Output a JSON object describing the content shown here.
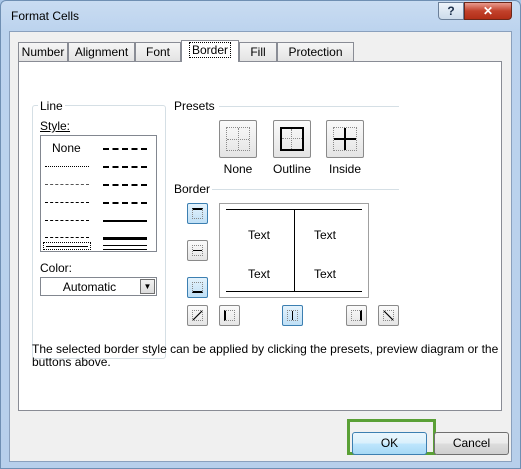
{
  "window": {
    "title": "Format Cells",
    "help_label": "?",
    "close_label": "✕"
  },
  "tabs": [
    {
      "label": "Number",
      "active": false
    },
    {
      "label": "Alignment",
      "active": false
    },
    {
      "label": "Font",
      "active": false
    },
    {
      "label": "Border",
      "active": true
    },
    {
      "label": "Fill",
      "active": false
    },
    {
      "label": "Protection",
      "active": false
    }
  ],
  "line": {
    "group_label": "Line",
    "style_label": "Style:",
    "none_label": "None",
    "color_label": "Color:",
    "color_value": "Automatic"
  },
  "presets": {
    "group_label": "Presets",
    "items": [
      {
        "label": "None",
        "icon": "preset-none-icon"
      },
      {
        "label": "Outline",
        "icon": "preset-outline-icon"
      },
      {
        "label": "Inside",
        "icon": "preset-inside-icon"
      }
    ]
  },
  "border": {
    "group_label": "Border",
    "preview_texts": [
      "Text",
      "Text",
      "Text",
      "Text"
    ]
  },
  "description": "The selected border style can be applied by clicking the presets, preview diagram or the buttons above.",
  "buttons": {
    "ok": "OK",
    "cancel": "Cancel"
  },
  "colors": {
    "highlight": "#5aa036",
    "accent": "#3c7fb1"
  }
}
